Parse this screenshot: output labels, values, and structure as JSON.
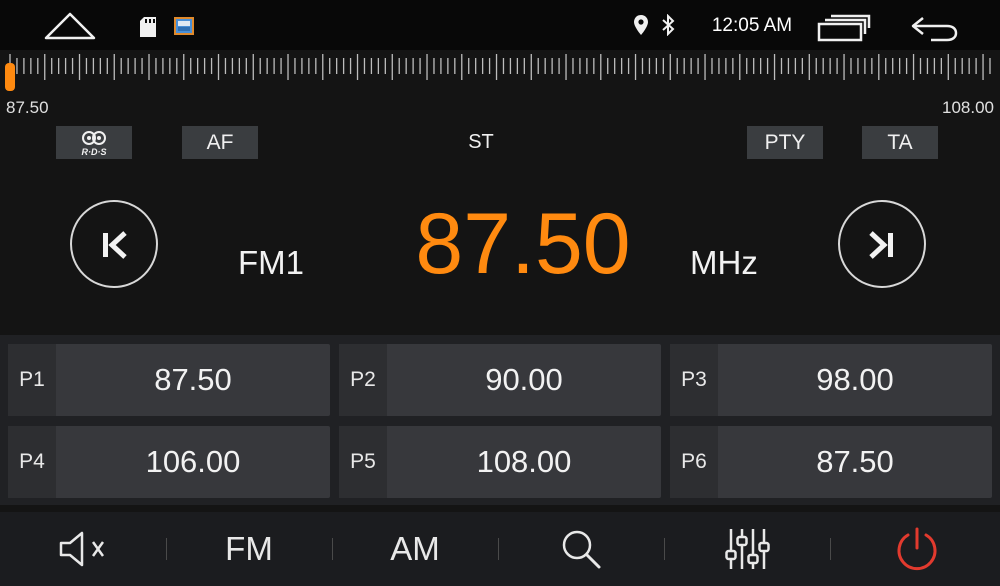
{
  "status_bar": {
    "time": "12:05 AM",
    "icons": [
      "home-icon",
      "sd-card-icon",
      "image-icon",
      "location-icon",
      "bluetooth-icon",
      "recent-apps-icon",
      "back-icon"
    ]
  },
  "dial": {
    "min_label": "87.50",
    "max_label": "108.00",
    "current_position": 0
  },
  "tags": {
    "rds": "R·D·S",
    "af": "AF",
    "st": "ST",
    "pty": "PTY",
    "ta": "TA"
  },
  "tuner": {
    "band": "FM1",
    "frequency": "87.50",
    "unit": "MHz",
    "frequency_color": "#ff8a10"
  },
  "presets": [
    {
      "label": "P1",
      "freq": "87.50"
    },
    {
      "label": "P2",
      "freq": "90.00"
    },
    {
      "label": "P3",
      "freq": "98.00"
    },
    {
      "label": "P4",
      "freq": "106.00"
    },
    {
      "label": "P5",
      "freq": "108.00"
    },
    {
      "label": "P6",
      "freq": "87.50"
    }
  ],
  "toolbar": {
    "mute_icon": "speaker-mute-icon",
    "fm_label": "FM",
    "am_label": "AM",
    "search_icon": "search-icon",
    "eq_icon": "equalizer-icon",
    "power_icon": "power-icon",
    "power_color": "#e23a2e"
  }
}
